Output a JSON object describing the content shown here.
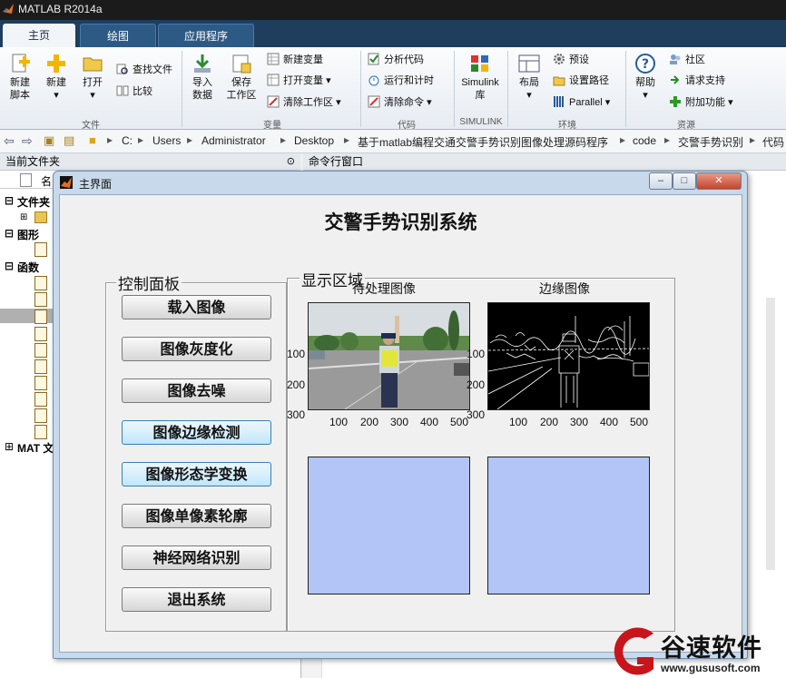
{
  "app": {
    "window_title": "MATLAB R2014a"
  },
  "tabs": [
    {
      "label": "主页",
      "active": true
    },
    {
      "label": "绘图",
      "active": false
    },
    {
      "label": "应用程序",
      "active": false
    }
  ],
  "ribbon": {
    "file": {
      "group": "文件",
      "new_script": "新建\n脚本",
      "new": "新建",
      "open": "打开",
      "find_files": "查找文件",
      "compare": "比较"
    },
    "variable": {
      "group": "变量",
      "import": "导入\n数据",
      "save_ws": "保存\n工作区",
      "new_var": "新建变量",
      "open_var": "打开变量",
      "clear_ws": "清除工作区"
    },
    "code": {
      "group": "代码",
      "analyze": "分析代码",
      "run_time": "运行和计时",
      "clear_cmd": "清除命令"
    },
    "simulink": {
      "group": "SIMULINK",
      "label": "Simulink\n库"
    },
    "env": {
      "group": "环境",
      "layout": "布局",
      "prefs": "预设",
      "set_path": "设置路径",
      "parallel": "Parallel"
    },
    "resources": {
      "group": "资源",
      "help": "帮助",
      "community": "社区",
      "support": "请求支持",
      "addons": "附加功能"
    }
  },
  "address": {
    "crumbs": [
      "C:",
      "Users",
      "Administrator",
      "Desktop",
      "基于matlab编程交通交警手势识别图像处理源码程序",
      "code",
      "交警手势识别",
      "代码"
    ]
  },
  "panels": {
    "current_folder": "当前文件夹",
    "command_window": "命令行窗口",
    "name_col": "名",
    "tree": [
      "文件夹",
      "图形",
      "函数",
      "MAT 文"
    ]
  },
  "figure": {
    "window_title": "主界面",
    "main_title": "交警手势识别系统",
    "control_panel": "控制面板",
    "display_area": "显示区域",
    "buttons": [
      {
        "label": "载入图像",
        "highlight": false
      },
      {
        "label": "图像灰度化",
        "highlight": false
      },
      {
        "label": "图像去噪",
        "highlight": false
      },
      {
        "label": "图像边缘检测",
        "highlight": true
      },
      {
        "label": "图像形态学变换",
        "highlight": true
      },
      {
        "label": "图像单像素轮廓",
        "highlight": false
      },
      {
        "label": "神经网络识别",
        "highlight": false
      },
      {
        "label": "退出系统",
        "highlight": false
      }
    ],
    "axes": [
      {
        "title": "待处理图像",
        "x_ticks": [
          "100",
          "200",
          "300",
          "400",
          "500"
        ],
        "y_ticks": [
          "100",
          "200",
          "300"
        ]
      },
      {
        "title": "边缘图像",
        "x_ticks": [
          "100",
          "200",
          "300",
          "400",
          "500"
        ],
        "y_ticks": [
          "100",
          "200",
          "300"
        ]
      }
    ],
    "blank_axes_color": "#b3c5f7"
  },
  "watermark": {
    "brand": "谷速软件",
    "url": "www.gususoft.com"
  }
}
